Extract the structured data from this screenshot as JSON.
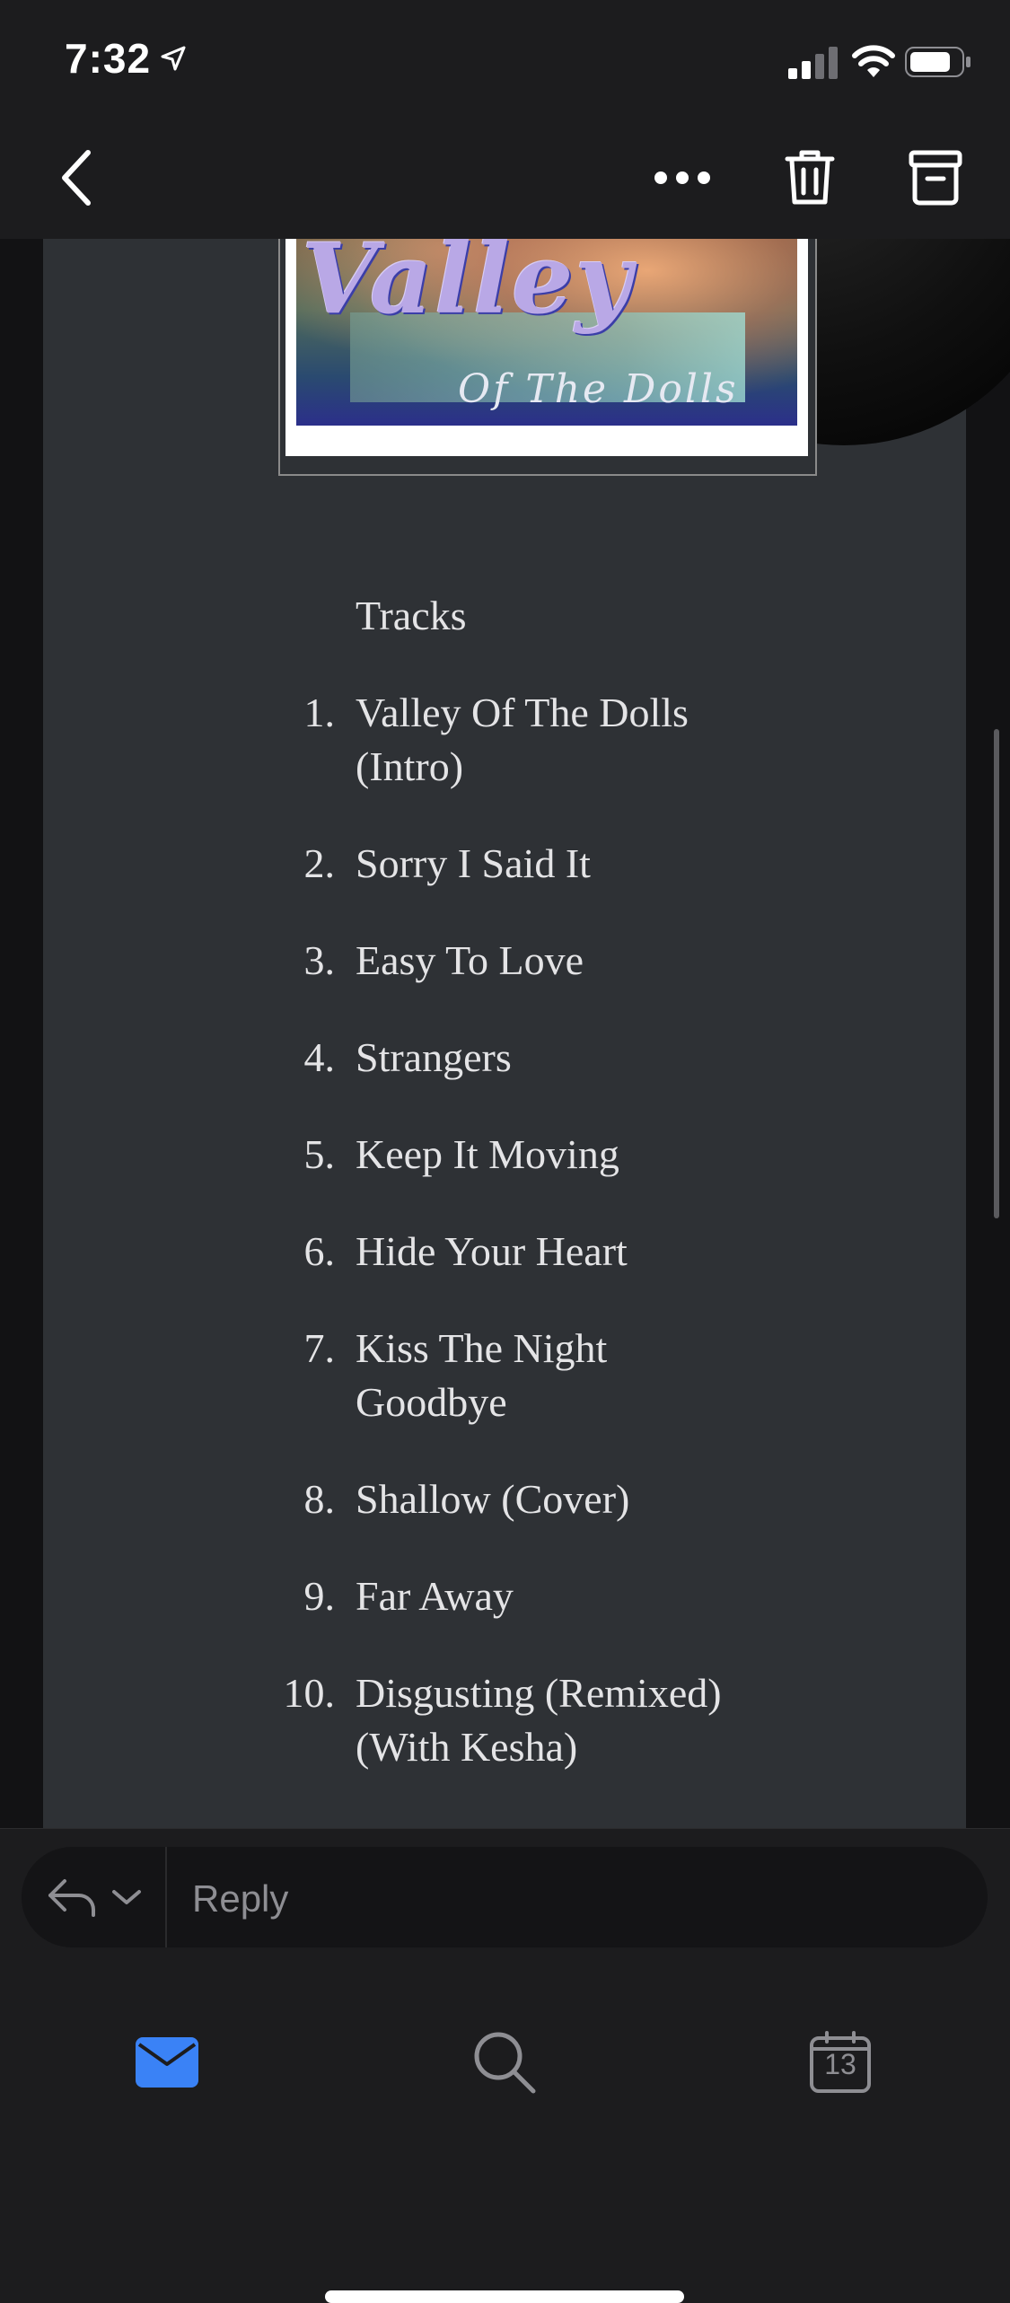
{
  "status_bar": {
    "time": "7:32"
  },
  "email": {
    "album_art": {
      "title": "Valley",
      "subtitle": "Of The Dolls"
    },
    "tracks_heading": "Tracks",
    "tracks": [
      {
        "num": "1.",
        "title": "Valley Of The Dolls (Intro)"
      },
      {
        "num": "2.",
        "title": "Sorry I Said It"
      },
      {
        "num": "3.",
        "title": "Easy To Love"
      },
      {
        "num": "4.",
        "title": "Strangers"
      },
      {
        "num": "5.",
        "title": "Keep It Moving"
      },
      {
        "num": "6.",
        "title": "Hide Your Heart"
      },
      {
        "num": "7.",
        "title": "Kiss The Night Goodbye"
      },
      {
        "num": "8.",
        "title": "Shallow (Cover)"
      },
      {
        "num": "9.",
        "title": "Far Away"
      },
      {
        "num": "10.",
        "title": "Disgusting (Remixed) (With Kesha)"
      }
    ]
  },
  "reply": {
    "placeholder": "Reply"
  },
  "tabs": {
    "calendar_day": "13"
  },
  "colors": {
    "accent": "#3a82f6",
    "body_bg": "#2e3135"
  }
}
